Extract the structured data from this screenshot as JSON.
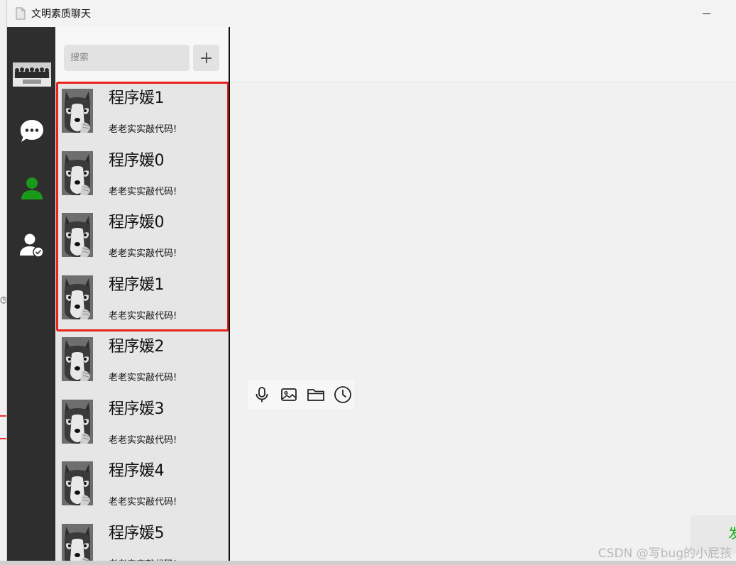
{
  "window": {
    "title": "文明素质聊天"
  },
  "search": {
    "placeholder": "搜索"
  },
  "contacts": [
    {
      "name": "程序媛1",
      "message": "老老实实敲代码!"
    },
    {
      "name": "程序媛0",
      "message": "老老实实敲代码!"
    },
    {
      "name": "程序媛0",
      "message": "老老实实敲代码!"
    },
    {
      "name": "程序媛1",
      "message": "老老实实敲代码!"
    },
    {
      "name": "程序媛2",
      "message": "老老实实敲代码!"
    },
    {
      "name": "程序媛3",
      "message": "老老实实敲代码!"
    },
    {
      "name": "程序媛4",
      "message": "老老实实敲代码!"
    },
    {
      "name": "程序媛5",
      "message": "老老实实敲代码!"
    }
  ],
  "chat": {
    "send_label": "发"
  },
  "nav": {
    "icons": [
      "chat-icon",
      "contacts-icon",
      "user-check-icon"
    ]
  },
  "toolbar": {
    "icons": [
      "microphone-icon",
      "image-icon",
      "folder-icon",
      "clock-icon"
    ]
  },
  "colors": {
    "nav_bg": "#2e2e2e",
    "highlight": "#e8231a",
    "contact_green": "#1a9a1a",
    "send_text": "#1aad19"
  },
  "watermark": "CSDN @写bug的小屁孩"
}
